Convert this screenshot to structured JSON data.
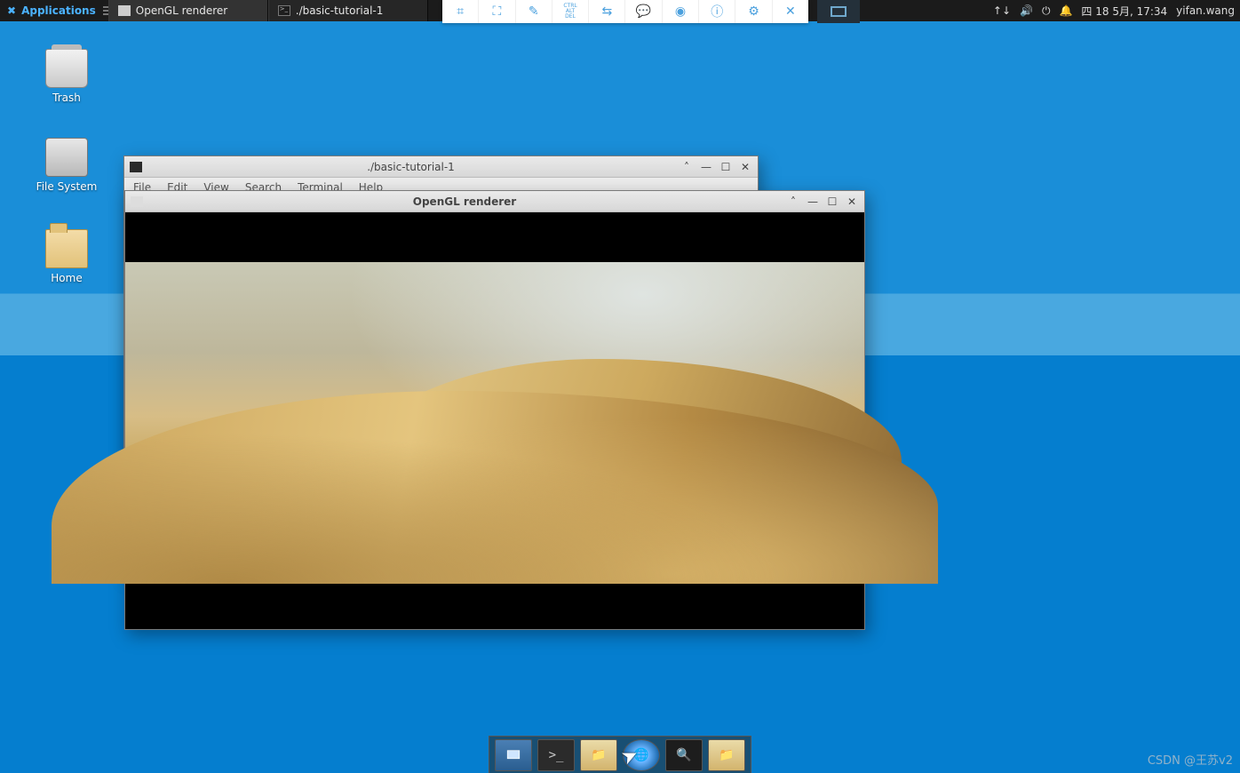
{
  "panel": {
    "applications_label": "Applications",
    "tasks": [
      {
        "label": "OpenGL renderer",
        "icon": "window"
      },
      {
        "label": "./basic-tutorial-1",
        "icon": "terminal"
      }
    ],
    "tray": {
      "network_icon": "↑↓",
      "volume_icon": "🔊",
      "power_icon": "⏻",
      "notify_icon": "🔔",
      "clock": "四 18 5月, 17:34",
      "user": "yifan.wang"
    }
  },
  "vnc_toolbar": {
    "items": [
      "⌗",
      "⛶",
      "✎",
      "CTRL\nALT\nDEL",
      "⇆",
      "💬",
      "◉",
      "ⓘ",
      "⚙",
      "✕"
    ]
  },
  "desktop_icons": [
    {
      "id": "trash",
      "label": "Trash"
    },
    {
      "id": "filesystem",
      "label": "File System"
    },
    {
      "id": "home",
      "label": "Home"
    }
  ],
  "terminal_window": {
    "title": "./basic-tutorial-1",
    "menu": [
      "File",
      "Edit",
      "View",
      "Search",
      "Terminal",
      "Help"
    ]
  },
  "gl_window": {
    "title": "OpenGL renderer"
  },
  "dock": {
    "items": [
      {
        "name": "show-desktop",
        "cls": "current"
      },
      {
        "name": "terminal",
        "cls": "term"
      },
      {
        "name": "file-manager",
        "cls": "files"
      },
      {
        "name": "web-browser",
        "cls": "web"
      },
      {
        "name": "search",
        "cls": "search"
      },
      {
        "name": "file-manager-2",
        "cls": "files"
      }
    ]
  },
  "watermark": "CSDN @王苏v2"
}
